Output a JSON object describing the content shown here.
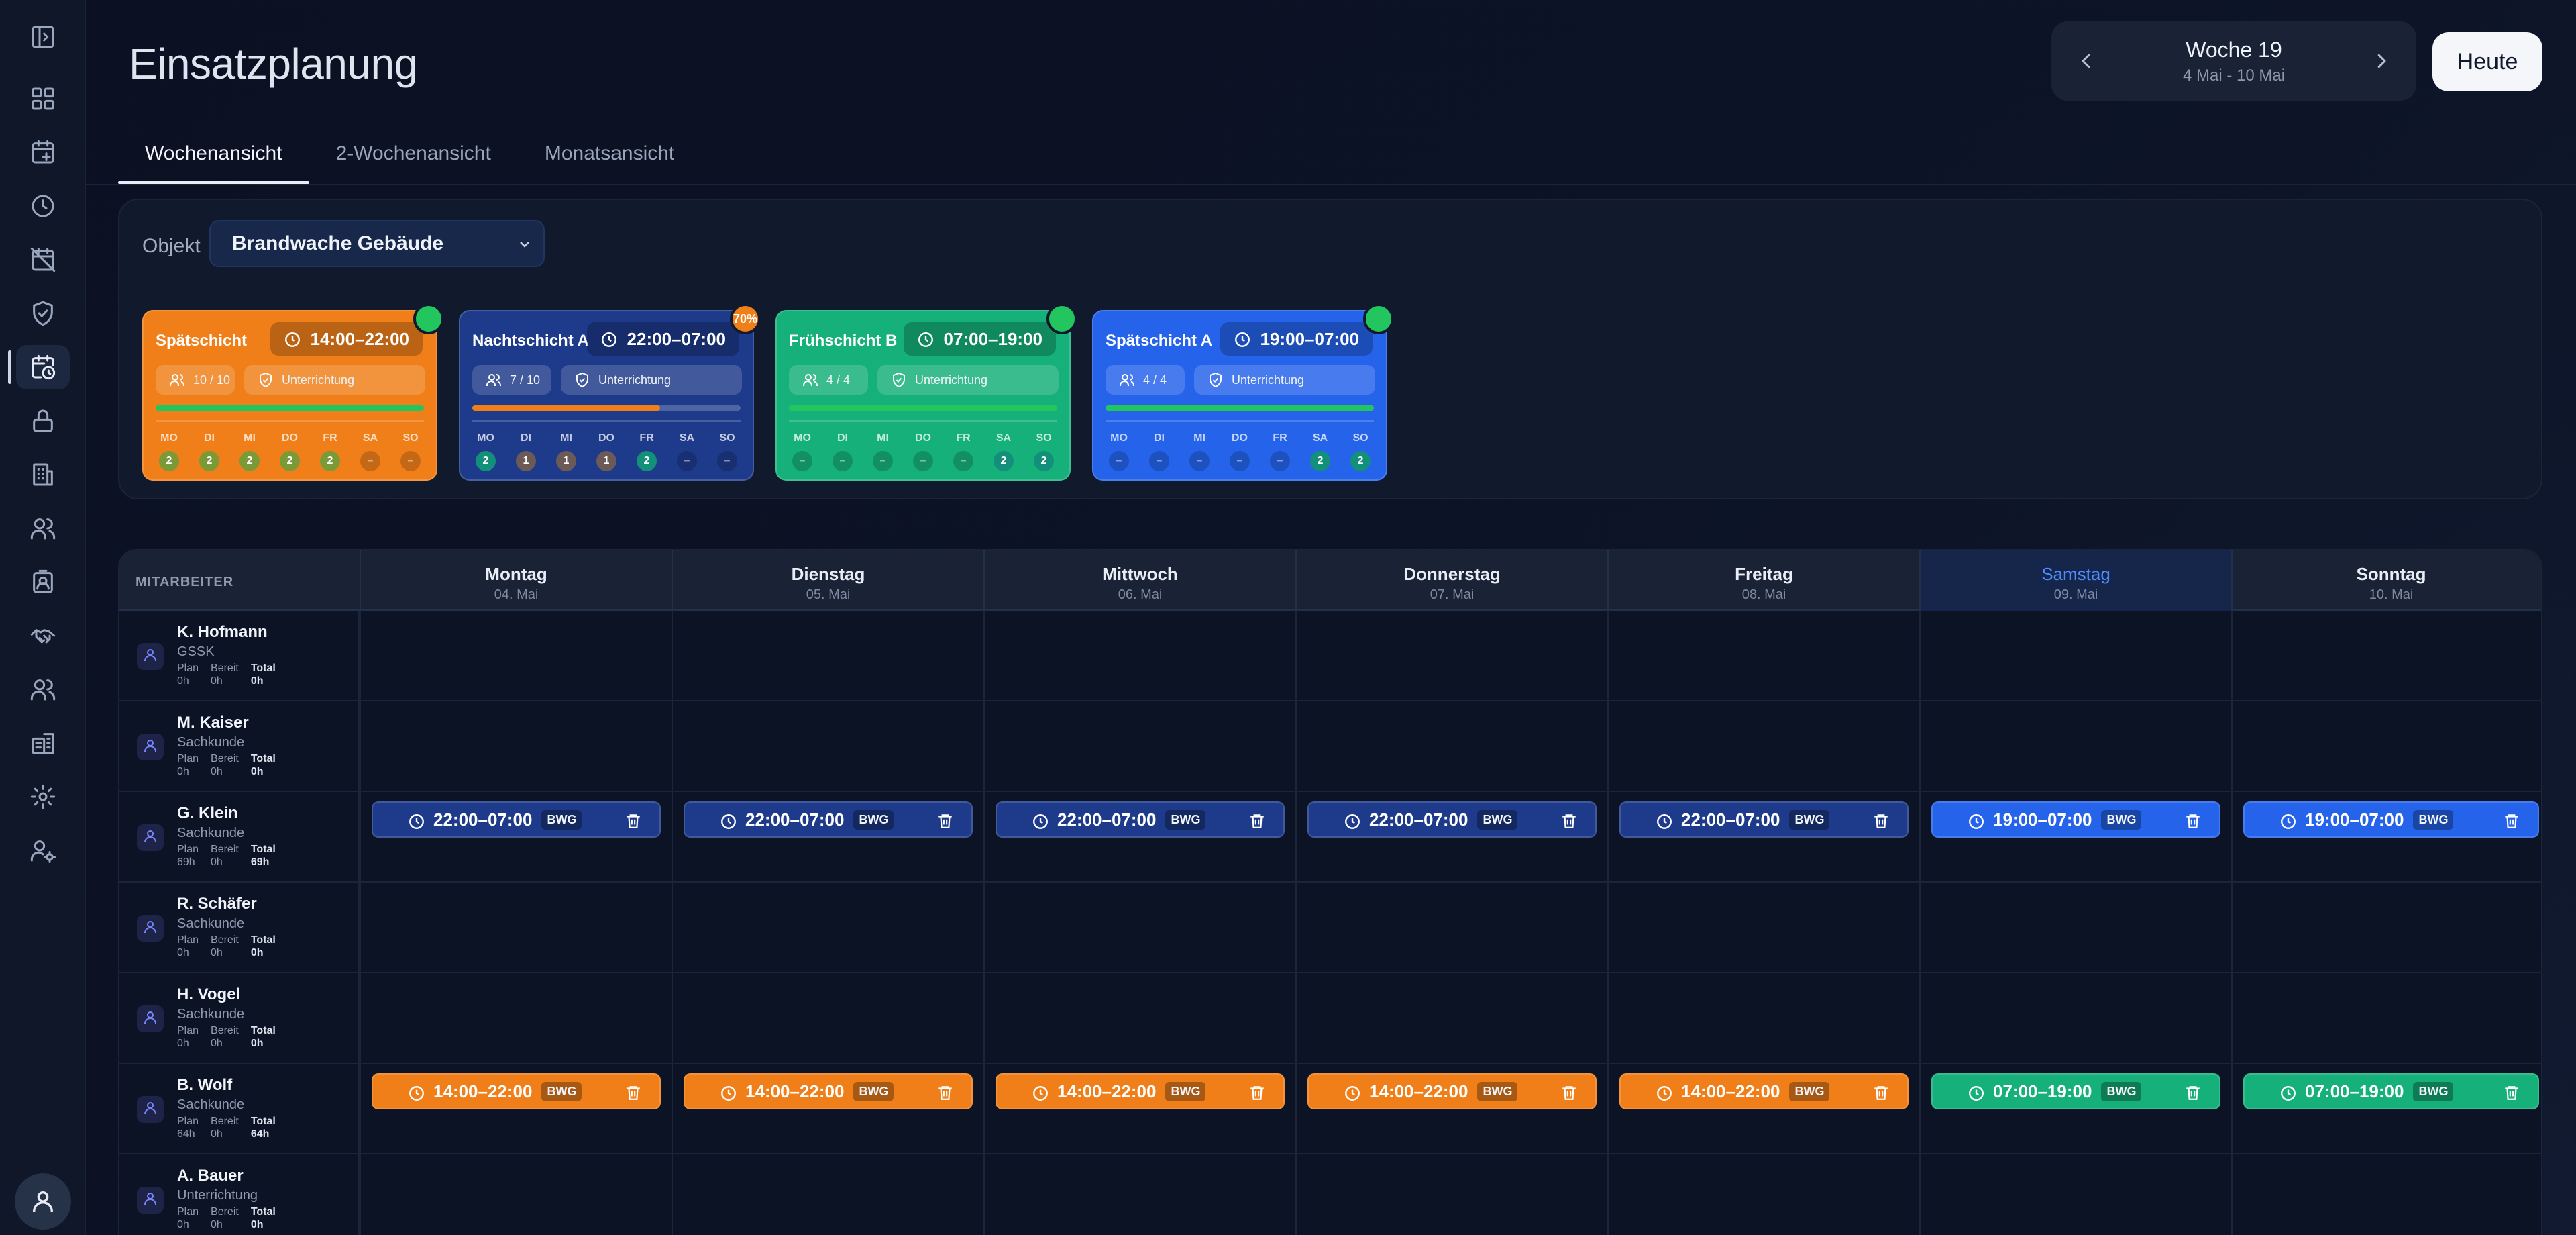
{
  "header": {
    "title": "Einsatzplanung",
    "week_label": "Woche 19",
    "week_range": "4 Mai - 10 Mai",
    "today_label": "Heute"
  },
  "tabs": [
    {
      "label": "Wochenansicht",
      "active": true
    },
    {
      "label": "2-Wochenansicht",
      "active": false
    },
    {
      "label": "Monatsansicht",
      "active": false
    }
  ],
  "object_filter": {
    "label": "Objekt",
    "value": "Brandwache Gebäude"
  },
  "shift_templates": [
    {
      "name": "Spätschicht",
      "time": "14:00–22:00",
      "staff": "10 / 10",
      "tag": "Unterrichtung",
      "color": "#f07f1a",
      "progress_color": "#22c55e",
      "progress": 1.0,
      "badge": "",
      "badge_color": "#22c55e",
      "days": [
        {
          "d": "MO",
          "c": "2"
        },
        {
          "d": "DI",
          "c": "2"
        },
        {
          "d": "MI",
          "c": "2"
        },
        {
          "d": "DO",
          "c": "2"
        },
        {
          "d": "FR",
          "c": "2"
        },
        {
          "d": "SA",
          "c": "–"
        },
        {
          "d": "SO",
          "c": "–"
        }
      ]
    },
    {
      "name": "Nachtschicht A",
      "time": "22:00–07:00",
      "staff": "7 / 10",
      "tag": "Unterrichtung",
      "color": "#1e3a8a",
      "progress_color": "#f07f1a",
      "progress": 0.7,
      "badge": "70%",
      "badge_color": "#f07f1a",
      "days": [
        {
          "d": "MO",
          "c": "2"
        },
        {
          "d": "DI",
          "c": "1"
        },
        {
          "d": "MI",
          "c": "1"
        },
        {
          "d": "DO",
          "c": "1"
        },
        {
          "d": "FR",
          "c": "2"
        },
        {
          "d": "SA",
          "c": "–"
        },
        {
          "d": "SO",
          "c": "–"
        }
      ]
    },
    {
      "name": "Frühschicht B",
      "time": "07:00–19:00",
      "staff": "4 / 4",
      "tag": "Unterrichtung",
      "color": "#16b07a",
      "progress_color": "#22c55e",
      "progress": 1.0,
      "badge": "",
      "badge_color": "#22c55e",
      "days": [
        {
          "d": "MO",
          "c": "–"
        },
        {
          "d": "DI",
          "c": "–"
        },
        {
          "d": "MI",
          "c": "–"
        },
        {
          "d": "DO",
          "c": "–"
        },
        {
          "d": "FR",
          "c": "–"
        },
        {
          "d": "SA",
          "c": "2"
        },
        {
          "d": "SO",
          "c": "2"
        }
      ]
    },
    {
      "name": "Spätschicht A",
      "time": "19:00–07:00",
      "staff": "4 / 4",
      "tag": "Unterrichtung",
      "color": "#2563eb",
      "progress_color": "#22c55e",
      "progress": 1.0,
      "badge": "",
      "badge_color": "#22c55e",
      "days": [
        {
          "d": "MO",
          "c": "–"
        },
        {
          "d": "DI",
          "c": "–"
        },
        {
          "d": "MI",
          "c": "–"
        },
        {
          "d": "DO",
          "c": "–"
        },
        {
          "d": "FR",
          "c": "–"
        },
        {
          "d": "SA",
          "c": "2"
        },
        {
          "d": "SO",
          "c": "2"
        }
      ]
    }
  ],
  "grid": {
    "employee_header": "MITARBEITER",
    "days": [
      {
        "name": "Montag",
        "date": "04. Mai",
        "today": false
      },
      {
        "name": "Dienstag",
        "date": "05. Mai",
        "today": false
      },
      {
        "name": "Mittwoch",
        "date": "06. Mai",
        "today": false
      },
      {
        "name": "Donnerstag",
        "date": "07. Mai",
        "today": false
      },
      {
        "name": "Freitag",
        "date": "08. Mai",
        "today": false
      },
      {
        "name": "Samstag",
        "date": "09. Mai",
        "today": true
      },
      {
        "name": "Sonntag",
        "date": "10. Mai",
        "today": false
      }
    ],
    "stat_labels": {
      "plan": "Plan",
      "ready": "Bereit",
      "total": "Total"
    },
    "employees": [
      {
        "name": "K. Hofmann",
        "role": "GSSK",
        "plan": "0h",
        "ready": "0h",
        "total": "0h",
        "shifts": [
          null,
          null,
          null,
          null,
          null,
          null,
          null
        ]
      },
      {
        "name": "M. Kaiser",
        "role": "Sachkunde",
        "plan": "0h",
        "ready": "0h",
        "total": "0h",
        "shifts": [
          null,
          null,
          null,
          null,
          null,
          null,
          null
        ]
      },
      {
        "name": "G. Klein",
        "role": "Sachkunde",
        "plan": "69h",
        "ready": "0h",
        "total": "69h",
        "shifts": [
          {
            "time": "22:00–07:00",
            "tag": "BWG",
            "color": "#1e3a8a"
          },
          {
            "time": "22:00–07:00",
            "tag": "BWG",
            "color": "#1e3a8a"
          },
          {
            "time": "22:00–07:00",
            "tag": "BWG",
            "color": "#1e3a8a"
          },
          {
            "time": "22:00–07:00",
            "tag": "BWG",
            "color": "#1e3a8a"
          },
          {
            "time": "22:00–07:00",
            "tag": "BWG",
            "color": "#1e3a8a"
          },
          {
            "time": "19:00–07:00",
            "tag": "BWG",
            "color": "#2563eb"
          },
          {
            "time": "19:00–07:00",
            "tag": "BWG",
            "color": "#2563eb"
          }
        ]
      },
      {
        "name": "R. Schäfer",
        "role": "Sachkunde",
        "plan": "0h",
        "ready": "0h",
        "total": "0h",
        "shifts": [
          null,
          null,
          null,
          null,
          null,
          null,
          null
        ]
      },
      {
        "name": "H. Vogel",
        "role": "Sachkunde",
        "plan": "0h",
        "ready": "0h",
        "total": "0h",
        "shifts": [
          null,
          null,
          null,
          null,
          null,
          null,
          null
        ]
      },
      {
        "name": "B. Wolf",
        "role": "Sachkunde",
        "plan": "64h",
        "ready": "0h",
        "total": "64h",
        "shifts": [
          {
            "time": "14:00–22:00",
            "tag": "BWG",
            "color": "#f07f1a"
          },
          {
            "time": "14:00–22:00",
            "tag": "BWG",
            "color": "#f07f1a"
          },
          {
            "time": "14:00–22:00",
            "tag": "BWG",
            "color": "#f07f1a"
          },
          {
            "time": "14:00–22:00",
            "tag": "BWG",
            "color": "#f07f1a"
          },
          {
            "time": "14:00–22:00",
            "tag": "BWG",
            "color": "#f07f1a"
          },
          {
            "time": "07:00–19:00",
            "tag": "BWG",
            "color": "#16b07a"
          },
          {
            "time": "07:00–19:00",
            "tag": "BWG",
            "color": "#16b07a"
          }
        ]
      },
      {
        "name": "A. Bauer",
        "role": "Unterrichtung",
        "plan": "0h",
        "ready": "0h",
        "total": "0h",
        "shifts": [
          null,
          null,
          null,
          null,
          null,
          null,
          null
        ]
      }
    ]
  }
}
